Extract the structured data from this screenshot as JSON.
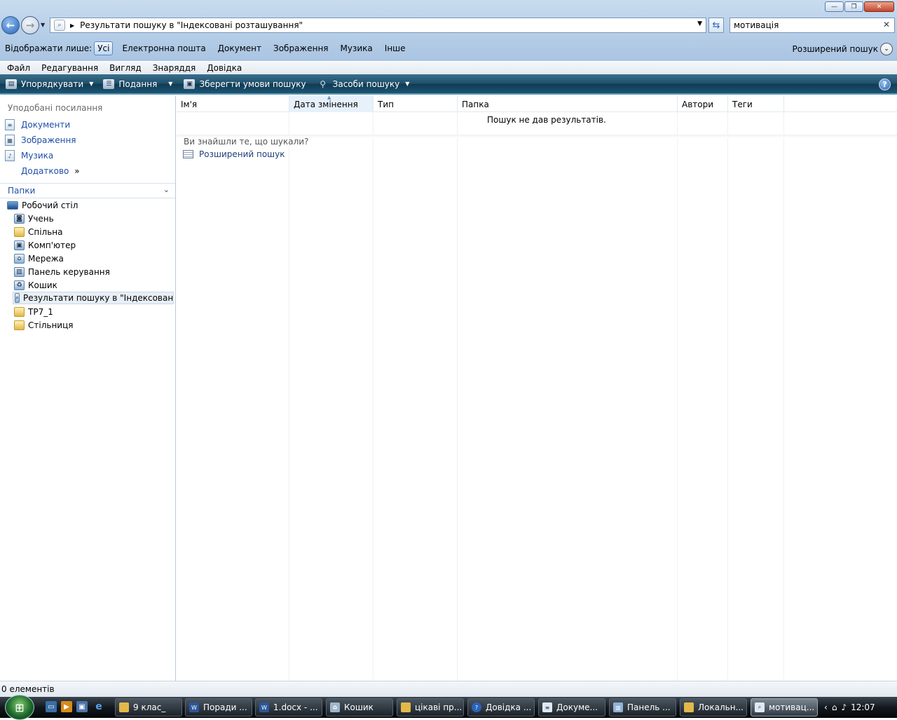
{
  "window": {
    "caption_buttons": {
      "minimize": "—",
      "maximize": "❐",
      "close": "✕"
    }
  },
  "address": {
    "path": "Результати пошуку в \"Індексовані розташування\""
  },
  "search": {
    "value": "мотивація"
  },
  "filter": {
    "label": "Відображати лише:",
    "items": [
      "Усі",
      "Електронна пошта",
      "Документ",
      "Зображення",
      "Музика",
      "Інше"
    ],
    "advanced": "Розширений пошук"
  },
  "menu": [
    "Файл",
    "Редагування",
    "Вигляд",
    "Знаряддя",
    "Довідка"
  ],
  "commands": {
    "organize": "Упорядкувати",
    "views": "Подання",
    "save": "Зберегти умови пошуку",
    "tools": "Засоби пошуку"
  },
  "nav": {
    "favorites_heading": "Уподобані посилання",
    "favorites": [
      "Документи",
      "Зображення",
      "Музика"
    ],
    "more": "Додатково",
    "more_glyph": "»",
    "folders_heading": "Папки",
    "tree": {
      "root": "Робочий стіл",
      "items": [
        "Учень",
        "Спільна",
        "Комп'ютер",
        "Мережа",
        "Панель керування",
        "Кошик",
        "Результати пошуку в \"Індексовані роз",
        "ТР7_1",
        "Стільниця"
      ]
    }
  },
  "columns": [
    "Ім'я",
    "Дата змінення",
    "Тип",
    "Папка",
    "Автори",
    "Теги"
  ],
  "results": {
    "empty_message": "Пошук не дав результатів.",
    "found_question": "Ви знайшли те, що шукали?",
    "advanced_link": "Розширений пошук"
  },
  "status": {
    "items": "0 елементів"
  },
  "taskbar": {
    "buttons": [
      "9 клас_",
      "Поради ...",
      "1.docx - ...",
      "Кошик",
      "цікаві пр...",
      "Довідка ...",
      "Докуме...",
      "Панель ...",
      "Локальн...",
      "мотивац..."
    ],
    "clock": "12:07"
  }
}
